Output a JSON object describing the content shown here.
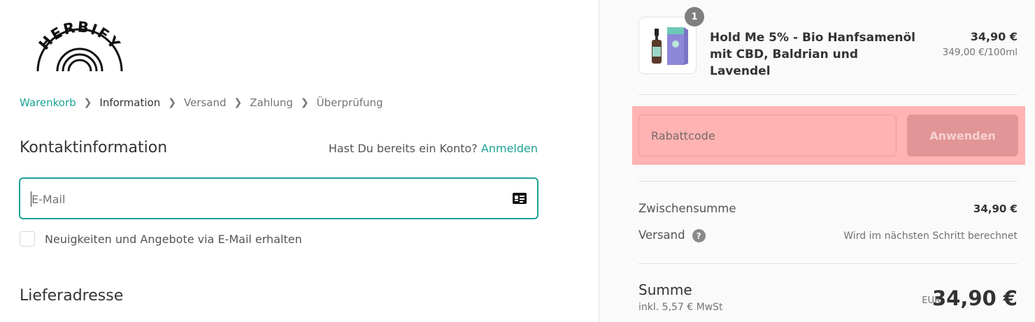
{
  "brand": {
    "logo_text": "HERBIFY"
  },
  "breadcrumb": {
    "items": [
      {
        "label": "Warenkorb",
        "state": "link"
      },
      {
        "label": "Information",
        "state": "current"
      },
      {
        "label": "Versand",
        "state": "upcoming"
      },
      {
        "label": "Zahlung",
        "state": "upcoming"
      },
      {
        "label": "Überprüfung",
        "state": "upcoming"
      }
    ],
    "separator_icon": "chevron-right-icon"
  },
  "contact": {
    "title": "Kontaktinformation",
    "account_prompt": "Hast Du bereits ein Konto?",
    "login_link": "Anmelden",
    "email_placeholder": "E-Mail",
    "email_value": "",
    "autofill_icon": "contact-card-icon",
    "newsletter_label": "Neuigkeiten und Angebote via E-Mail erhalten",
    "newsletter_checked": false
  },
  "shipping": {
    "title": "Lieferadresse"
  },
  "summary": {
    "product": {
      "quantity": "1",
      "name": "Hold Me 5% - Bio Hanfsamenöl mit CBD, Baldrian und Lavendel",
      "price": "34,90 €",
      "unit_price": "349,00 €/100ml"
    },
    "discount": {
      "placeholder": "Rabattcode",
      "apply_label": "Anwenden"
    },
    "subtotal_label": "Zwischensumme",
    "subtotal_value": "34,90 €",
    "shipping_label": "Versand",
    "shipping_help_icon": "question-circle-icon",
    "shipping_value": "Wird im nächsten Schritt berechnet",
    "total_label": "Summe",
    "tax_note": "inkl. 5,57 € MwSt",
    "currency": "EUR",
    "total_value": "34,90 €"
  },
  "colors": {
    "accent": "#1aa293",
    "highlight": "#ffb3b3",
    "apply_button": "#e29596"
  }
}
